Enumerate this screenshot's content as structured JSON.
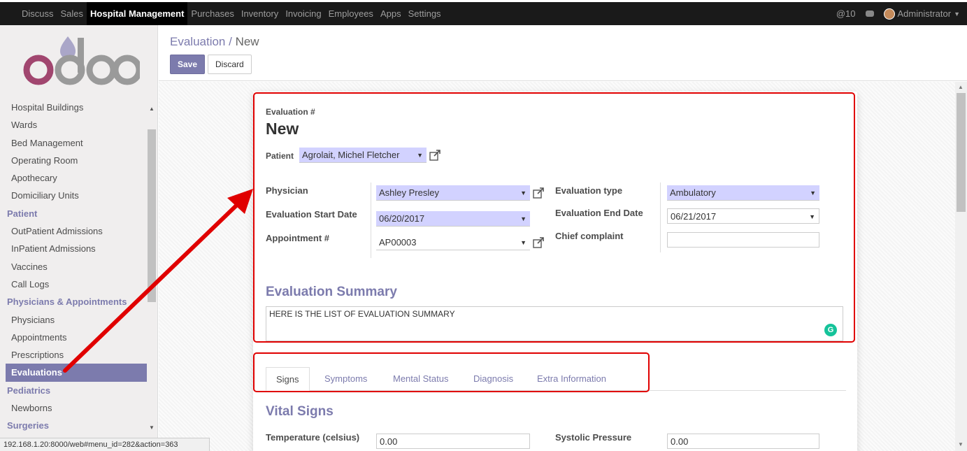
{
  "topnav": {
    "menu": [
      "Discuss",
      "Sales",
      "Hospital Management",
      "Purchases",
      "Inventory",
      "Invoicing",
      "Employees",
      "Apps",
      "Settings"
    ],
    "active": "Hospital Management",
    "mentions": "@10",
    "user": "Administrator"
  },
  "sidebar": {
    "logo_text": "odoo",
    "items": [
      {
        "label": "Hospital Buildings",
        "type": "item"
      },
      {
        "label": "Wards",
        "type": "item"
      },
      {
        "label": "Bed Management",
        "type": "item"
      },
      {
        "label": "Operating Room",
        "type": "item"
      },
      {
        "label": "Apothecary",
        "type": "item"
      },
      {
        "label": "Domiciliary Units",
        "type": "item"
      },
      {
        "label": "Patient",
        "type": "header"
      },
      {
        "label": "OutPatient Admissions",
        "type": "item"
      },
      {
        "label": "InPatient Admissions",
        "type": "item"
      },
      {
        "label": "Vaccines",
        "type": "item"
      },
      {
        "label": "Call Logs",
        "type": "item"
      },
      {
        "label": "Physicians & Appointments",
        "type": "header"
      },
      {
        "label": "Physicians",
        "type": "item"
      },
      {
        "label": "Appointments",
        "type": "item"
      },
      {
        "label": "Prescriptions",
        "type": "item"
      },
      {
        "label": "Evaluations",
        "type": "item",
        "active": true
      },
      {
        "label": "Pediatrics",
        "type": "header"
      },
      {
        "label": "Newborns",
        "type": "item"
      },
      {
        "label": "Surgeries",
        "type": "header"
      }
    ],
    "status_url": "192.168.1.20:8000/web#menu_id=282&action=363"
  },
  "control_panel": {
    "breadcrumb_parent": "Evaluation",
    "breadcrumb_sep": " / ",
    "breadcrumb_current": "New",
    "save_label": "Save",
    "discard_label": "Discard"
  },
  "form": {
    "number_label": "Evaluation #",
    "number_value": "New",
    "patient_label": "Patient",
    "patient_value": "Agrolait, Michel Fletcher",
    "physician_label": "Physician",
    "physician_value": "Ashley Presley",
    "start_label": "Evaluation Start Date",
    "start_value": "06/20/2017",
    "appointment_label": "Appointment #",
    "appointment_value": "AP00003",
    "type_label": "Evaluation type",
    "type_value": "Ambulatory",
    "end_label": "Evaluation End Date",
    "end_value": "06/21/2017",
    "complaint_label": "Chief complaint",
    "complaint_value": "",
    "summary_title": "Evaluation Summary",
    "summary_value": "HERE IS THE LIST OF EVALUATION SUMMARY",
    "tabs": [
      "Signs",
      "Symptoms",
      "Mental Status",
      "Diagnosis",
      "Extra Information"
    ],
    "active_tab": "Signs",
    "vital_title": "Vital Signs",
    "temp_label": "Temperature (celsius)",
    "temp_value": "0.00",
    "systolic_label": "Systolic Pressure",
    "systolic_value": "0.00"
  },
  "colors": {
    "brand": "#7c7bad",
    "annotation_red": "#e00000",
    "required_bg": "#d2d2ff"
  }
}
